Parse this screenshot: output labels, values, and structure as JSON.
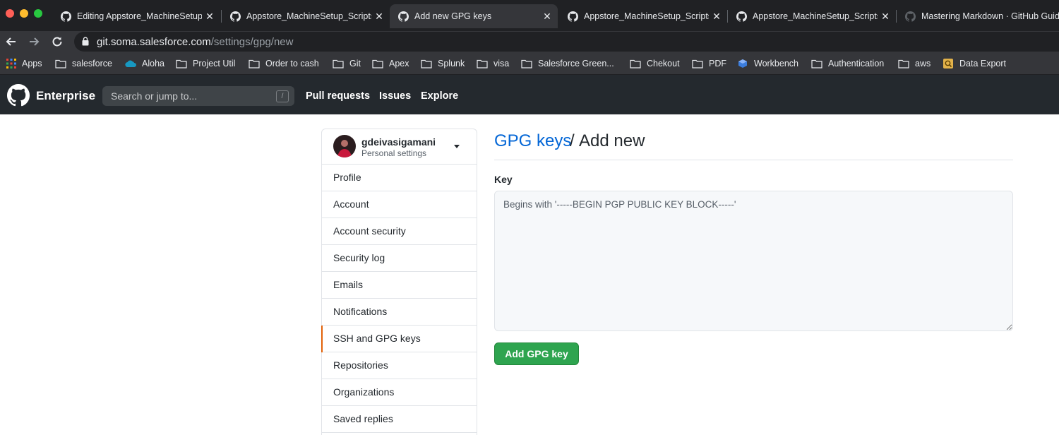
{
  "browser": {
    "tabs": [
      {
        "title": "Editing Appstore_MachineSetup_Scripts",
        "favicon": "github-icon",
        "active": false
      },
      {
        "title": "Appstore_MachineSetup_Scripts",
        "favicon": "github-icon",
        "active": false
      },
      {
        "title": "Add new GPG keys",
        "favicon": "github-icon",
        "active": true
      },
      {
        "title": "Appstore_MachineSetup_Scripts",
        "favicon": "github-icon",
        "active": false
      },
      {
        "title": "Appstore_MachineSetup_Scripts",
        "favicon": "github-icon",
        "active": false
      },
      {
        "title": "Mastering Markdown · GitHub Guides",
        "favicon": "github-icon",
        "active": false
      }
    ],
    "tab_close_glyph": "✕",
    "url_host": "git.soma.salesforce.com",
    "url_path": "/settings/gpg/new",
    "bookmarks": [
      {
        "label": "Apps",
        "icon": "apps-grid-icon"
      },
      {
        "label": "salesforce",
        "icon": "folder-icon"
      },
      {
        "label": "Aloha",
        "icon": "salesforce-cloud-icon"
      },
      {
        "label": "Project Util",
        "icon": "folder-icon"
      },
      {
        "label": "Order to cash",
        "icon": "folder-icon"
      },
      {
        "label": "Git",
        "icon": "folder-icon"
      },
      {
        "label": "Apex",
        "icon": "folder-icon"
      },
      {
        "label": "Splunk",
        "icon": "folder-icon"
      },
      {
        "label": "visa",
        "icon": "folder-icon"
      },
      {
        "label": "Salesforce Green...",
        "icon": "folder-icon"
      },
      {
        "label": "Chekout",
        "icon": "folder-icon"
      },
      {
        "label": "PDF",
        "icon": "folder-icon"
      },
      {
        "label": "Workbench",
        "icon": "workbench-cube-icon"
      },
      {
        "label": "Authentication",
        "icon": "folder-icon"
      },
      {
        "label": "aws",
        "icon": "folder-icon"
      },
      {
        "label": "Data Export",
        "icon": "data-export-icon"
      }
    ]
  },
  "header": {
    "brand": "Enterprise",
    "search_placeholder": "Search or jump to...",
    "search_shortcut": "/",
    "nav": [
      "Pull requests",
      "Issues",
      "Explore"
    ]
  },
  "sidebar": {
    "username": "gdeivasigamani",
    "subtitle": "Personal settings",
    "items": [
      {
        "label": "Profile"
      },
      {
        "label": "Account"
      },
      {
        "label": "Account security"
      },
      {
        "label": "Security log"
      },
      {
        "label": "Emails"
      },
      {
        "label": "Notifications"
      },
      {
        "label": "SSH and GPG keys",
        "selected": true
      },
      {
        "label": "Repositories"
      },
      {
        "label": "Organizations"
      },
      {
        "label": "Saved replies"
      }
    ]
  },
  "main": {
    "breadcrumb_link": "GPG keys",
    "breadcrumb_sep": "/",
    "title": "Add new",
    "key_label": "Key",
    "key_placeholder": "Begins with '-----BEGIN PGP PUBLIC KEY BLOCK-----'",
    "submit_label": "Add GPG key"
  },
  "colors": {
    "link": "#0366d6",
    "primary_button": "#2ea44f",
    "header_bg": "#24292e",
    "selected_accent": "#e36209"
  }
}
